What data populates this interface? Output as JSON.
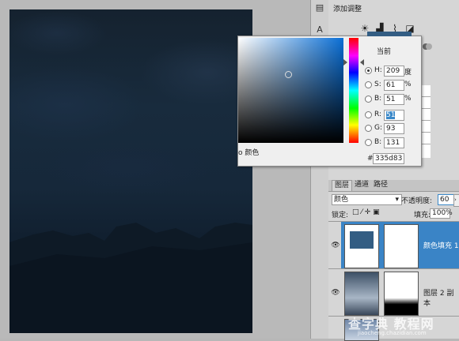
{
  "adjustments": {
    "title": "添加调整",
    "icons": [
      "sun-icon",
      "levels-icon",
      "curves-icon",
      "exposure-icon"
    ]
  },
  "color_picker": {
    "current_label": "当前",
    "only_web_colors_label": "颜色",
    "new_color": "#335d83",
    "fields": {
      "h": {
        "label": "H:",
        "value": "209",
        "unit": "度"
      },
      "s": {
        "label": "S:",
        "value": "61",
        "unit": "%"
      },
      "b": {
        "label": "B:",
        "value": "51",
        "unit": "%"
      },
      "r": {
        "label": "R:",
        "value": "51"
      },
      "g": {
        "label": "G:",
        "value": "93"
      },
      "bl": {
        "label": "B:",
        "value": "131"
      }
    },
    "hex_prefix": "#",
    "hex": "335d83"
  },
  "layers": {
    "tabs": [
      "图层",
      "通道",
      "路径"
    ],
    "blend_mode": "颜色",
    "opacity_label": "不透明度:",
    "opacity_value": "60",
    "lock_label": "锁定:",
    "fill_label": "填充:",
    "fill_value": "100%",
    "items": [
      {
        "name": "颜色填充 1",
        "selected": true
      },
      {
        "name": "图层 2 副本",
        "selected": false
      }
    ]
  },
  "watermark": {
    "text": "查字典 教程网",
    "url": "jiaocheng.chazidian.com"
  }
}
